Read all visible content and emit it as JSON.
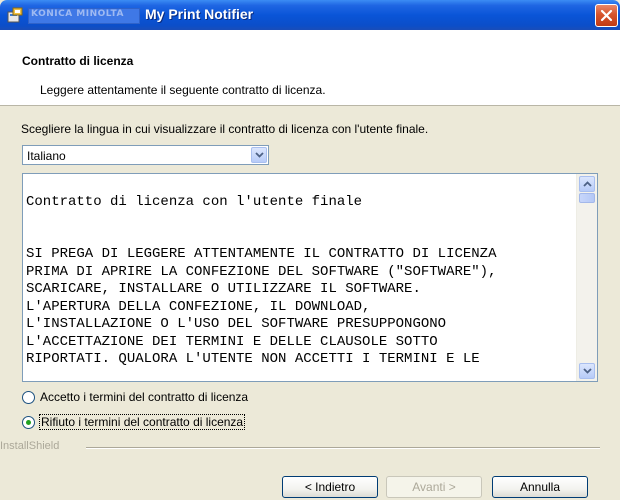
{
  "titlebar": {
    "brand": "KONICA MINOLTA",
    "title": "My Print Notifier"
  },
  "header": {
    "title": "Contratto di licenza",
    "subtitle": "Leggere attentamente il seguente contratto di licenza."
  },
  "language": {
    "prompt": "Scegliere la lingua in cui visualizzare il contratto di licenza con l'utente finale.",
    "selected": "Italiano"
  },
  "license": {
    "lines": [
      "",
      "Contratto di licenza con l'utente finale",
      "",
      "",
      "SI PREGA DI LEGGERE ATTENTAMENTE IL CONTRATTO DI LICENZA",
      "PRIMA DI APRIRE LA CONFEZIONE DEL SOFTWARE (\"SOFTWARE\"),",
      "SCARICARE, INSTALLARE O UTILIZZARE IL SOFTWARE.",
      "L'APERTURA DELLA CONFEZIONE, IL DOWNLOAD,",
      "L'INSTALLAZIONE O L'USO DEL SOFTWARE PRESUPPONGONO",
      "L'ACCETTAZIONE DEI TERMINI E DELLE CLAUSOLE SOTTO",
      "RIPORTATI. QUALORA L'UTENTE NON ACCETTI I TERMINI E LE"
    ]
  },
  "options": {
    "accept_label": "Accetto i termini del contratto di licenza",
    "decline_label": "Rifiuto i termini del contratto di licenza",
    "selected": "decline"
  },
  "footer": {
    "brand": "InstallShield",
    "back_label": "< Indietro",
    "next_label": "Avanti >",
    "cancel_label": "Annulla"
  }
}
